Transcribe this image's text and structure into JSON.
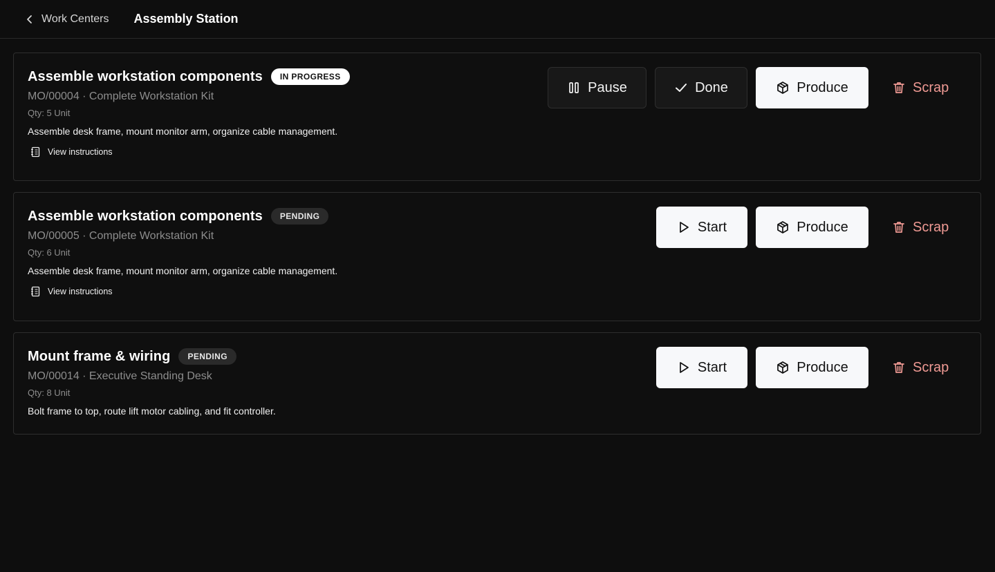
{
  "header": {
    "back_label": "Work Centers",
    "title": "Assembly Station"
  },
  "cards": [
    {
      "title": "Assemble workstation components",
      "status": "IN PROGRESS",
      "subline": "MO/00004 · Complete Workstation Kit",
      "qty": "Qty: 5 Unit",
      "description": "Assemble desk frame, mount monitor arm, organize cable management.",
      "instructions_label": "View instructions",
      "actions": {
        "pause": "Pause",
        "done": "Done",
        "produce": "Produce",
        "scrap": "Scrap"
      }
    },
    {
      "title": "Assemble workstation components",
      "status": "PENDING",
      "subline": "MO/00005 · Complete Workstation Kit",
      "qty": "Qty: 6 Unit",
      "description": "Assemble desk frame, mount monitor arm, organize cable management.",
      "instructions_label": "View instructions",
      "actions": {
        "start": "Start",
        "produce": "Produce",
        "scrap": "Scrap"
      }
    },
    {
      "title": "Mount frame & wiring",
      "status": "PENDING",
      "subline": "MO/00014 · Executive Standing Desk",
      "qty": "Qty: 8 Unit",
      "description": "Bolt frame to top, route lift motor cabling, and fit controller.",
      "actions": {
        "start": "Start",
        "produce": "Produce",
        "scrap": "Scrap"
      }
    }
  ],
  "colors": {
    "background": "#0e0e0e",
    "scrap": "#f09a94",
    "light_button": "#f7f8fa"
  },
  "icons": [
    "chevron-left-icon",
    "pause-icon",
    "check-icon",
    "package-icon",
    "trash-icon",
    "play-icon",
    "notebook-icon"
  ]
}
